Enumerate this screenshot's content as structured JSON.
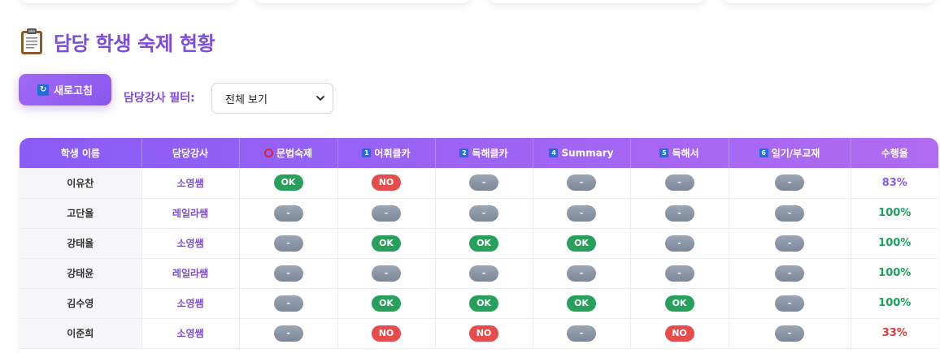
{
  "header": {
    "title": "담당 학생 숙제 현황",
    "title_icon": "clipboard-icon"
  },
  "toolbar": {
    "refresh_label": "새로고침",
    "refresh_icon": "refresh-icon",
    "filter_label": "담당강사 필터:",
    "filter_value": "전체 보기"
  },
  "table": {
    "columns": [
      {
        "label": "학생 이름",
        "icon": ""
      },
      {
        "label": "담당강사",
        "icon": ""
      },
      {
        "label": "문법숙제",
        "icon": "red-circle-icon"
      },
      {
        "label": "어휘클카",
        "icon": "keycap-1-icon",
        "glyph": "1"
      },
      {
        "label": "독해클카",
        "icon": "keycap-2-icon",
        "glyph": "2"
      },
      {
        "label": "Summary",
        "icon": "keycap-4-icon",
        "glyph": "4"
      },
      {
        "label": "독해서",
        "icon": "keycap-5-icon",
        "glyph": "5"
      },
      {
        "label": "일기/부교재",
        "icon": "keycap-6-icon",
        "glyph": "6"
      },
      {
        "label": "수행율",
        "icon": ""
      }
    ],
    "rows": [
      {
        "name": "이유찬",
        "teacher": "소영쌤",
        "status": [
          "OK",
          "NO",
          "-",
          "-",
          "-",
          "-"
        ],
        "rate": "83%",
        "rate_color": "#8b5cf6"
      },
      {
        "name": "고단율",
        "teacher": "레일라쌤",
        "status": [
          "-",
          "-",
          "-",
          "-",
          "-",
          "-"
        ],
        "rate": "100%",
        "rate_color": "#1aa25a"
      },
      {
        "name": "강태율",
        "teacher": "소영쌤",
        "status": [
          "-",
          "OK",
          "OK",
          "OK",
          "-",
          "-"
        ],
        "rate": "100%",
        "rate_color": "#1aa25a"
      },
      {
        "name": "강태윤",
        "teacher": "레일라쌤",
        "status": [
          "-",
          "-",
          "-",
          "-",
          "-",
          "-"
        ],
        "rate": "100%",
        "rate_color": "#1aa25a"
      },
      {
        "name": "김수영",
        "teacher": "소영쌤",
        "status": [
          "-",
          "OK",
          "OK",
          "OK",
          "OK",
          "-"
        ],
        "rate": "100%",
        "rate_color": "#1aa25a"
      },
      {
        "name": "이준희",
        "teacher": "소영쌤",
        "status": [
          "-",
          "NO",
          "NO",
          "-",
          "NO",
          "-"
        ],
        "rate": "33%",
        "rate_color": "#e03a3a"
      }
    ]
  },
  "colors": {
    "accent": "#7c4ddc",
    "ok": "#27a05b",
    "no": "#e74c4c",
    "na": "#8a96a6"
  }
}
